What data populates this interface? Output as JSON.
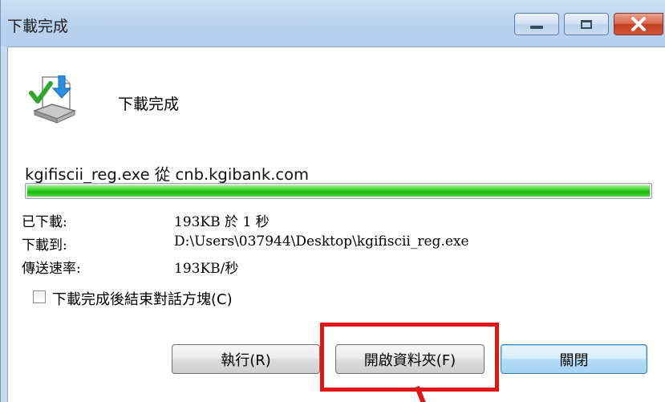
{
  "window": {
    "title": "下載完成"
  },
  "titlebar_controls": {
    "minimize": "minimize-icon",
    "maximize": "maximize-icon",
    "close": "close-icon"
  },
  "content": {
    "heading": "下載完成",
    "source": "kgifiscii_reg.exe 從 cnb.kgibank.com",
    "progress_percent": 100,
    "progress_color": "#22c010",
    "details": [
      {
        "label": "已下載:",
        "value": "193KB 於 1 秒"
      },
      {
        "label": "下載到:",
        "value": "D:\\Users\\037944\\Desktop\\kgifiscii_reg.exe"
      },
      {
        "label": "傳送速率:",
        "value": "193KB/秒"
      }
    ],
    "close_when_done": {
      "label": "下載完成後結束對話方塊(C)",
      "checked": false
    }
  },
  "buttons": {
    "run": "執行(R)",
    "open_folder": "開啟資料夾(F)",
    "close": "關閉"
  },
  "annotation": {
    "highlight_color": "#e01616"
  }
}
